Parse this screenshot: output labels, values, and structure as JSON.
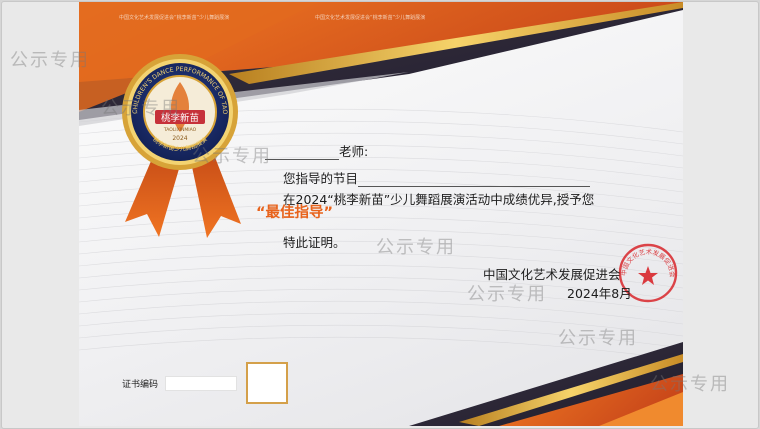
{
  "header": {
    "tiny_text_1": "中国文化艺术发展促进会“桃李新苗”少儿舞蹈展演",
    "tiny_text_2": "中国文化艺术发展促进会“桃李新苗”少儿舞蹈展演"
  },
  "medal": {
    "ring_text": "CHILDREN'S DANCE PERFORMANCE OF TAOLIXINMIAO",
    "title": "桃李新苗",
    "subtitle": "TAOLIXINMIAO",
    "year": "2024",
    "bottom_text": "桃李新苗少儿舞蹈展演"
  },
  "body": {
    "teacher_suffix": "老师:",
    "line1": "您指导的节目",
    "line2": "在2024“桃李新苗”少儿舞蹈展演活动中成绩优异,授予您",
    "award": "“最佳指导”",
    "closing": "特此证明。"
  },
  "issuer": {
    "org": "中国文化艺术发展促进会",
    "date": "2024年8月",
    "stamp_text": "中国文化艺术发展促进会"
  },
  "footer": {
    "cert_no_label": "证书编码"
  },
  "watermark": {
    "text": "公示专用"
  },
  "colors": {
    "accent_orange": "#e8631c",
    "ribbon_orange": "#e5601a",
    "dark_navy": "#2a2638",
    "gold": "#e2b443",
    "stamp_red": "#d8262a"
  }
}
